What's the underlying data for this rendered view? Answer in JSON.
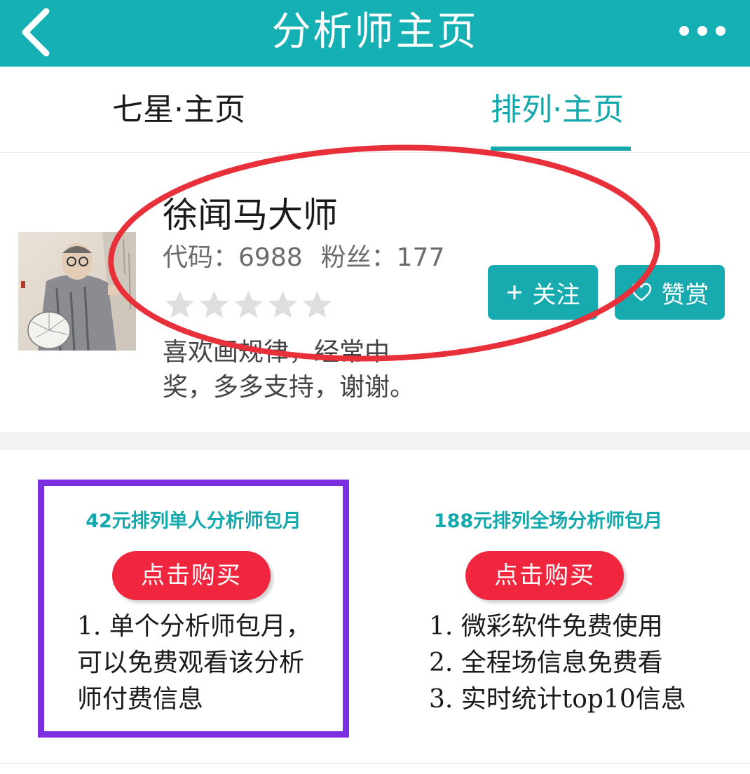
{
  "header": {
    "title": "分析师主页",
    "back_icon": "chevron-left-icon",
    "more_icon": "more-dots-icon",
    "background": "#14b0b4"
  },
  "tabs": [
    {
      "label": "七星·主页",
      "active": false
    },
    {
      "label": "排列·主页",
      "active": true
    }
  ],
  "profile": {
    "name": "徐闻马大师",
    "code_label": "代码：",
    "code_value": "6988",
    "fans_label": "粉丝：",
    "fans_value": "177",
    "rating": 0,
    "rating_max": 5,
    "bio_line1": "喜欢画规律，经常中",
    "bio_line2": "奖，多多支持，谢谢。"
  },
  "actions": {
    "follow_label": "关注",
    "follow_icon": "plus-icon",
    "tip_label": "赞赏",
    "tip_icon": "heart-icon"
  },
  "plans": [
    {
      "title": "42元排列单人分析师包月",
      "button": "点击购买",
      "desc_lines": [
        "1. 单个分析师包月，",
        "可以免费观看该分析",
        "师付费信息"
      ]
    },
    {
      "title": "188元排列全场分析师包月",
      "button": "点击购买",
      "desc_lines": [
        "1. 微彩软件免费使用",
        "2. 全程场信息免费看",
        "3. 实时统计top10信息"
      ]
    }
  ],
  "annotations": {
    "ellipse_color": "#e8303a",
    "box_color": "#7c2fe0"
  }
}
